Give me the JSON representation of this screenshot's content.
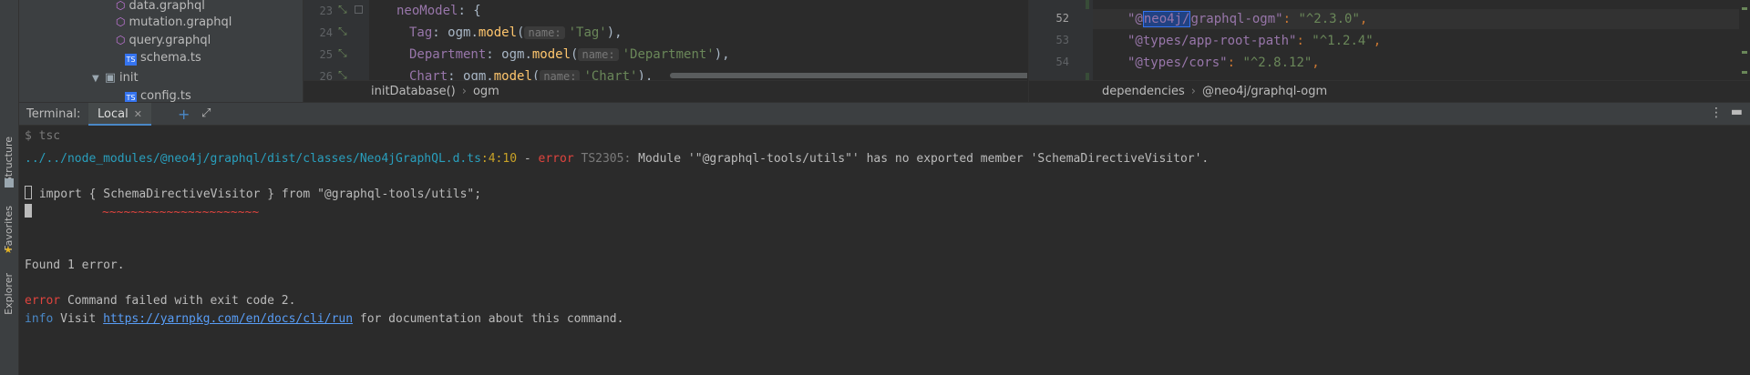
{
  "left_strip": {
    "tabs": [
      {
        "label": "Structure",
        "icon": "structure-icon"
      },
      {
        "label": "Favorites",
        "icon": "star-icon"
      },
      {
        "label": "Explorer",
        "icon": "explorer-icon"
      }
    ]
  },
  "project_tree": {
    "items": [
      {
        "label": "data.graphql",
        "icon": "graphql-icon"
      },
      {
        "label": "mutation.graphql",
        "icon": "graphql-icon"
      },
      {
        "label": "query.graphql",
        "icon": "graphql-icon"
      },
      {
        "label": "schema.ts",
        "icon": "typescript-icon"
      },
      {
        "label": "init",
        "icon": "folder-icon"
      },
      {
        "label": "config.ts",
        "icon": "typescript-icon"
      }
    ]
  },
  "editor_left": {
    "line_numbers": [
      "23",
      "24",
      "25",
      "26"
    ],
    "lines": [
      {
        "prop": "neoModel",
        "rest": ": {"
      },
      {
        "prop": "Tag",
        "sep": ": ogm.",
        "fn": "model",
        "open": "(",
        "hint": "name:",
        "str": "'Tag'",
        "close": "),"
      },
      {
        "prop": "Department",
        "sep": ": ogm.",
        "fn": "model",
        "open": "(",
        "hint": "name:",
        "str": "'Department'",
        "close": "),"
      },
      {
        "prop": "Chart",
        "sep": ": ogm.",
        "fn": "model",
        "open": "(",
        "hint": "name:",
        "str": "'Chart'",
        "close": "),"
      }
    ],
    "breadcrumb": [
      "initDatabase()",
      "ogm"
    ]
  },
  "editor_right": {
    "line_numbers": [
      "52",
      "53",
      "54"
    ],
    "lines": [
      {
        "key_pre": "\"@",
        "key_sel": "neo4j/",
        "key_post": "graphql-ogm\"",
        "value": "\"^2.3.0\""
      },
      {
        "key": "\"@types/app-root-path\"",
        "value": "\"^1.2.4\""
      },
      {
        "key": "\"@types/cors\"",
        "value": "\"^2.8.12\""
      }
    ],
    "breadcrumb": [
      "dependencies",
      "@neo4j/graphql-ogm"
    ]
  },
  "terminal": {
    "label": "Terminal:",
    "tab": "Local",
    "prompt": "$ tsc",
    "error_path": "../../node_modules/@neo4j/graphql/dist/classes/Neo4jGraphQL.d.ts",
    "error_pos": ":4:10",
    "error_dash": " - ",
    "error_word": "error",
    "error_code": " TS2305:",
    "error_msg": " Module '\"@graphql-tools/utils\"' has no exported member 'SchemaDirectiveVisitor'.",
    "code_snippet": " import { SchemaDirectiveVisitor } from \"@graphql-tools/utils\";",
    "squiggle": "~~~~~~~~~~~~~~~~~~~~~~",
    "found": "Found 1 error.",
    "cmd_error_word": "error",
    "cmd_error_msg": " Command failed with exit code 2.",
    "info_word": "info",
    "info_pre": " Visit ",
    "info_link": "https://yarnpkg.com/en/docs/cli/run",
    "info_post": " for documentation about this command."
  }
}
